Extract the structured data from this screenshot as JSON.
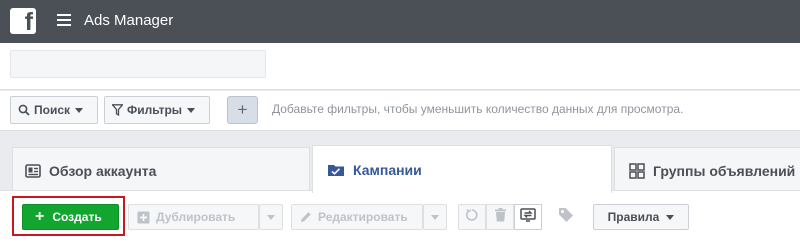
{
  "header": {
    "logo_letter": "f",
    "app_title": "Ads Manager"
  },
  "filters": {
    "search_label": "Поиск",
    "filters_label": "Фильтры",
    "add_label": "+",
    "hint": "Добавьте фильтры, чтобы уменьшить количество данных для просмотра."
  },
  "tabs": [
    {
      "label": "Обзор аккаунта",
      "icon": "account-overview-icon",
      "active": false
    },
    {
      "label": "Кампании",
      "icon": "folder-icon",
      "active": true
    },
    {
      "label": "Группы объявлений",
      "icon": "grid-icon",
      "active": false
    }
  ],
  "toolbar": {
    "create_label": "Создать",
    "create_plus": "+",
    "duplicate_label": "Дублировать",
    "edit_label": "Редактировать",
    "rules_label": "Правила"
  },
  "colors": {
    "topbar": "#4b4f56",
    "create_green": "#12a530",
    "highlight_red": "#c8181f",
    "active_tab_text": "#365899"
  }
}
